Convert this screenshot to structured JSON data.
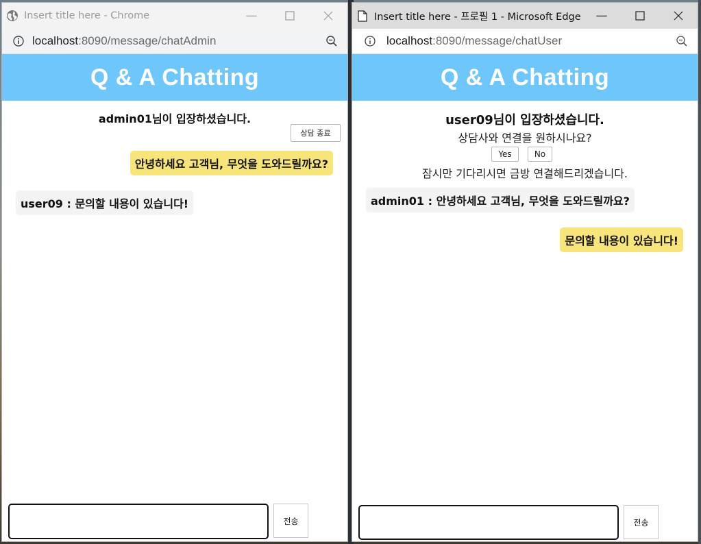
{
  "colors": {
    "header_bg": "#6ec6fb",
    "my_bubble": "#f7e47a",
    "other_bubble": "#f3f3f3"
  },
  "left_window": {
    "browser": "Chrome",
    "title": "Insert title here - Chrome",
    "icon": "globe-icon",
    "url_host": "localhost",
    "url_path": ":8090/message/chatAdmin",
    "app_title": "Q & A Chatting",
    "system_message": "admin01님이 입장하셨습니다.",
    "end_button": "상담 종료",
    "messages": [
      {
        "from": "me",
        "text": "안녕하세요 고객님, 무엇을 도와드릴까요?"
      },
      {
        "from": "other",
        "text": "user09 : 문의할 내용이 있습니다!"
      }
    ],
    "input_value": "",
    "send_button": "전송"
  },
  "right_window": {
    "browser": "Microsoft Edge",
    "title": "Insert title here - 프로필 1 - Microsoft Edge",
    "icon": "page-icon",
    "url_host": "localhost",
    "url_path": ":8090/message/chatUser",
    "app_title": "Q & A Chatting",
    "system_message": "user09님이 입장하셨습니다.",
    "question": "상담사와 연결을 원하시나요?",
    "yes_button": "Yes",
    "no_button": "No",
    "wait_message": "잠시만 기다리시면 금방 연결해드리겠습니다.",
    "messages": [
      {
        "from": "other",
        "text": "admin01 : 안녕하세요 고객님, 무엇을 도와드릴까요?"
      },
      {
        "from": "me",
        "text": "문의할 내용이 있습니다!"
      }
    ],
    "input_value": "",
    "send_button": "전송"
  }
}
